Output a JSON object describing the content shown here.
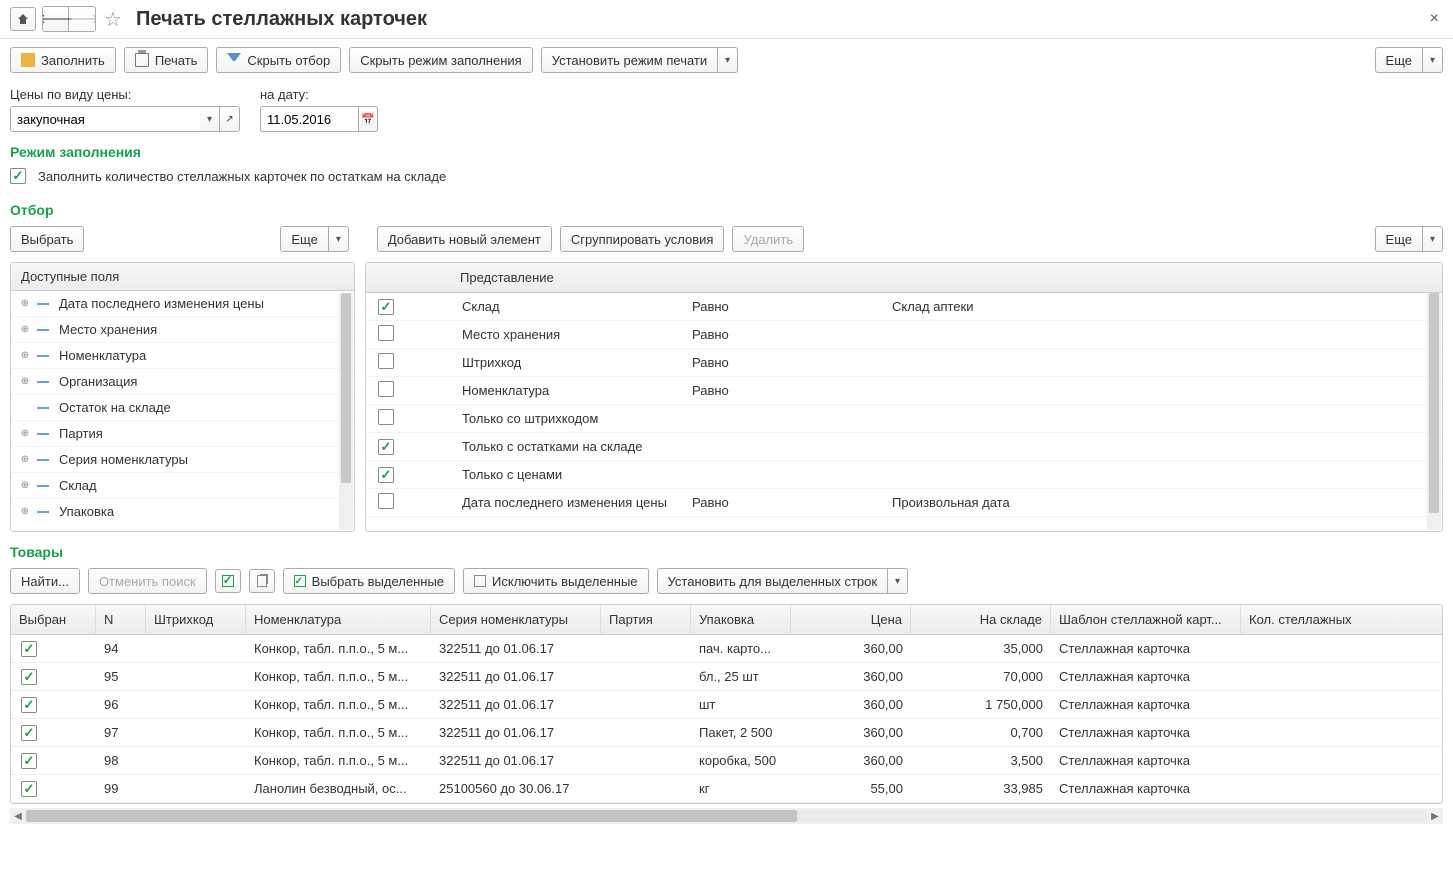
{
  "header": {
    "title": "Печать стеллажных карточек"
  },
  "toolbar": {
    "fill": "Заполнить",
    "print": "Печать",
    "hide_filter": "Скрыть отбор",
    "hide_fill_mode": "Скрыть режим заполнения",
    "set_print_mode": "Установить режим печати",
    "more": "Еще"
  },
  "form": {
    "price_type_label": "Цены по виду цены:",
    "price_type_value": "закупочная",
    "date_label": "на дату:",
    "date_value": "11.05.2016"
  },
  "fill_mode": {
    "heading": "Режим заполнения",
    "checkbox_label": "Заполнить количество стеллажных карточек по остаткам на складе"
  },
  "filter": {
    "heading": "Отбор",
    "select_btn": "Выбрать",
    "more": "Еще",
    "add_btn": "Добавить новый элемент",
    "group_btn": "Сгруппировать условия",
    "delete_btn": "Удалить",
    "available_header": "Доступные поля",
    "available_fields": [
      {
        "exp": true,
        "label": "Дата последнего изменения цены"
      },
      {
        "exp": true,
        "label": "Место хранения"
      },
      {
        "exp": true,
        "label": "Номенклатура"
      },
      {
        "exp": true,
        "label": "Организация"
      },
      {
        "exp": false,
        "label": "Остаток на складе"
      },
      {
        "exp": true,
        "label": "Партия"
      },
      {
        "exp": true,
        "label": "Серия номенклатуры"
      },
      {
        "exp": true,
        "label": "Склад"
      },
      {
        "exp": true,
        "label": "Упаковка"
      }
    ],
    "repr_header": "Представление",
    "rows": [
      {
        "checked": true,
        "dash": true,
        "pres": "Склад",
        "op": "Равно",
        "val": "Склад аптеки"
      },
      {
        "checked": false,
        "dash": true,
        "pres": "Место хранения",
        "op": "Равно",
        "val": ""
      },
      {
        "checked": false,
        "dash": true,
        "pres": "Штрихкод",
        "op": "Равно",
        "val": ""
      },
      {
        "checked": false,
        "dash": true,
        "pres": "Номенклатура",
        "op": "Равно",
        "val": ""
      },
      {
        "checked": false,
        "dash": false,
        "pres": "Только со штрихкодом",
        "op": "",
        "val": ""
      },
      {
        "checked": true,
        "dash": false,
        "pres": "Только с остатками на складе",
        "op": "",
        "val": ""
      },
      {
        "checked": true,
        "dash": false,
        "pres": "Только с ценами",
        "op": "",
        "val": ""
      },
      {
        "checked": false,
        "dash": true,
        "pres": "Дата последнего изменения цены",
        "op": "Равно",
        "val": "Произвольная дата"
      }
    ]
  },
  "goods": {
    "heading": "Товары",
    "find_btn": "Найти...",
    "cancel_search_btn": "Отменить поиск",
    "select_highlighted": "Выбрать выделенные",
    "exclude_highlighted": "Исключить выделенные",
    "set_for_selected": "Установить для выделенных строк",
    "columns": {
      "sel": "Выбран",
      "n": "N",
      "bar": "Штрихкод",
      "nom": "Номенклатура",
      "ser": "Серия номенклатуры",
      "par": "Партия",
      "pack": "Упаковка",
      "price": "Цена",
      "stock": "На складе",
      "tpl": "Шаблон стеллажной карт...",
      "cnt": "Кол. стеллажных"
    },
    "rows": [
      {
        "sel": true,
        "n": "94",
        "nom": "Конкор, табл. п.п.о., 5 м...",
        "ser": "322511 до 01.06.17",
        "pack": "пач. карто...",
        "price": "360,00",
        "stock": "35,000",
        "tpl": "Стеллажная карточка"
      },
      {
        "sel": true,
        "n": "95",
        "nom": "Конкор, табл. п.п.о., 5 м...",
        "ser": "322511 до 01.06.17",
        "pack": "бл., 25 шт",
        "price": "360,00",
        "stock": "70,000",
        "tpl": "Стеллажная карточка"
      },
      {
        "sel": true,
        "n": "96",
        "nom": "Конкор, табл. п.п.о., 5 м...",
        "ser": "322511 до 01.06.17",
        "pack": "шт",
        "price": "360,00",
        "stock": "1 750,000",
        "tpl": "Стеллажная карточка"
      },
      {
        "sel": true,
        "n": "97",
        "nom": "Конкор, табл. п.п.о., 5 м...",
        "ser": "322511 до 01.06.17",
        "pack": "Пакет, 2 500",
        "price": "360,00",
        "stock": "0,700",
        "tpl": "Стеллажная карточка"
      },
      {
        "sel": true,
        "n": "98",
        "nom": "Конкор, табл. п.п.о., 5 м...",
        "ser": "322511 до 01.06.17",
        "pack": "коробка, 500",
        "price": "360,00",
        "stock": "3,500",
        "tpl": "Стеллажная карточка"
      },
      {
        "sel": true,
        "n": "99",
        "nom": "Ланолин безводный, ос...",
        "ser": "25100560 до 30.06.17",
        "pack": "кг",
        "price": "55,00",
        "stock": "33,985",
        "tpl": "Стеллажная карточка"
      }
    ]
  }
}
